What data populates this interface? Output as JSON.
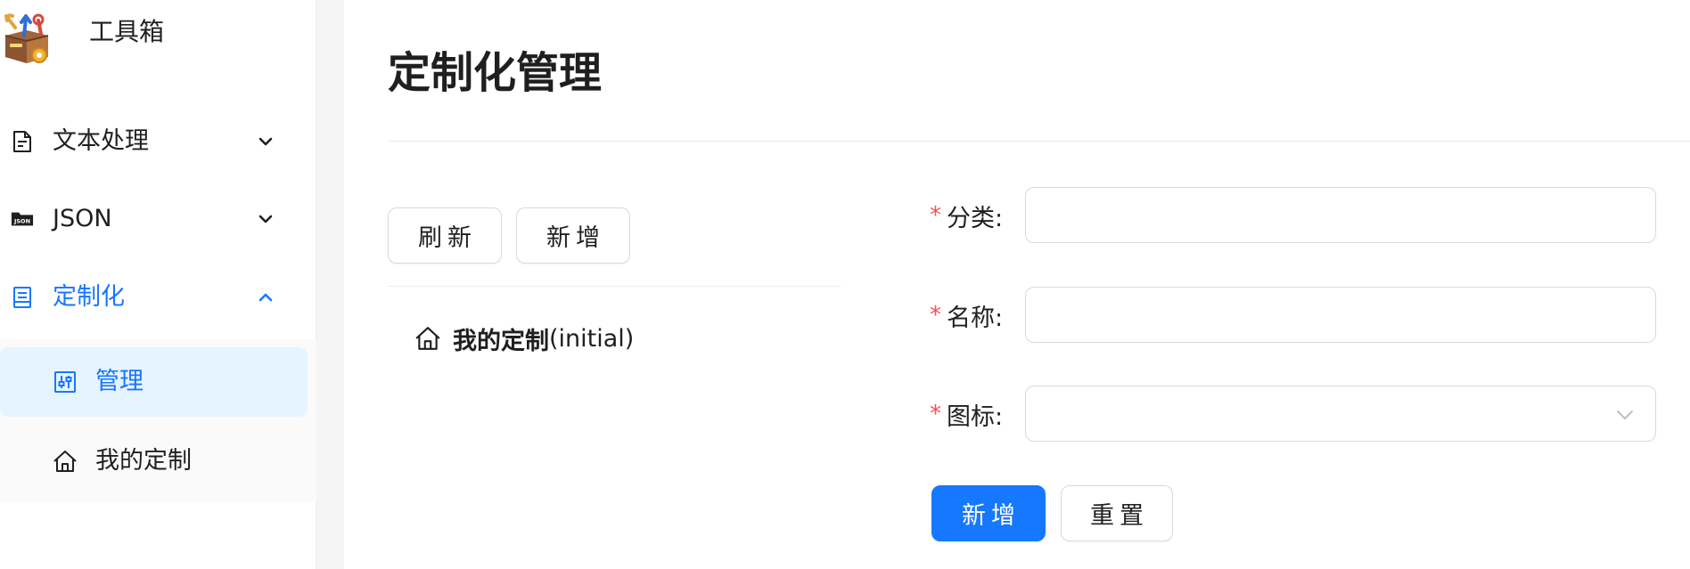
{
  "app": {
    "title": "工具箱"
  },
  "sidebar": {
    "items": [
      {
        "label": "文本处理",
        "icon": "file-text-icon",
        "expanded": false
      },
      {
        "label": "JSON",
        "icon": "json-folder-icon",
        "expanded": false
      },
      {
        "label": "定制化",
        "icon": "container-icon",
        "expanded": true,
        "active": true
      }
    ],
    "subitems": [
      {
        "label": "管理",
        "icon": "sliders-icon",
        "selected": true
      },
      {
        "label": "我的定制",
        "icon": "home-icon",
        "selected": false
      }
    ]
  },
  "main": {
    "title": "定制化管理",
    "toolbar": {
      "refresh_label": "刷新",
      "add_label": "新增"
    },
    "tree": [
      {
        "name": "我的定制",
        "suffix": "(initial)",
        "icon": "home-icon"
      }
    ]
  },
  "form": {
    "category": {
      "label": "分类:",
      "value": ""
    },
    "name": {
      "label": "名称:",
      "value": ""
    },
    "icon": {
      "label": "图标:",
      "value": ""
    },
    "required_mark": "*",
    "submit_label": "新增",
    "reset_label": "重置"
  },
  "colors": {
    "primary": "#1677ff",
    "selected_bg": "#e6f4ff",
    "required": "#ff4d4f",
    "border": "#d9d9d9"
  }
}
